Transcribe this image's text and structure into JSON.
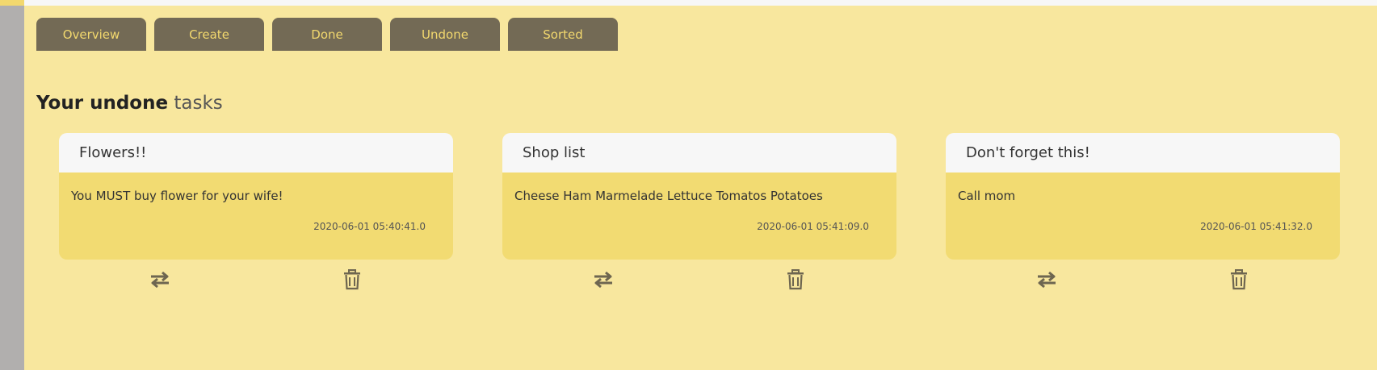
{
  "nav": {
    "tabs": [
      {
        "label": "Overview"
      },
      {
        "label": "Create"
      },
      {
        "label": "Done"
      },
      {
        "label": "Undone"
      },
      {
        "label": "Sorted"
      }
    ]
  },
  "heading": {
    "strong": "Your undone",
    "rest": "tasks"
  },
  "tasks": [
    {
      "title": "Flowers!!",
      "text": "You MUST buy flower for your wife!",
      "date": "2020-06-01 05:40:41.0"
    },
    {
      "title": "Shop list",
      "text": "Cheese Ham Marmelade Lettuce Tomatos Potatoes",
      "date": "2020-06-01 05:41:09.0"
    },
    {
      "title": "Don't forget this!",
      "text": "Call mom",
      "date": "2020-06-01 05:41:32.0"
    }
  ],
  "icons": {
    "toggle": "swap-arrows-icon",
    "delete": "trash-icon"
  },
  "colors": {
    "background": "#f8e79e",
    "tab": "#736a55",
    "tab_text": "#f2d86e",
    "card_body": "#f2db72",
    "card_header": "#f7f7f7"
  }
}
